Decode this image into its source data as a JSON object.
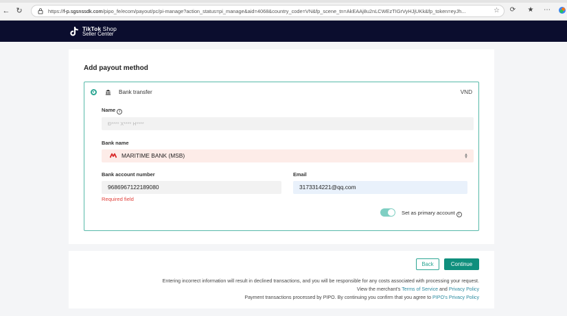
{
  "browser": {
    "url_prefix": "https://",
    "url_host": "f-p.sgsnssdk.com",
    "url_rest": "/pipo_fe/ecom/payout/pc/pi-manage?action_status=pi_manage&aid=4068&country_code=VN&fp_scene_tn=AkEAAj8u2nLCWEzTIGrVyHJjUKk&fp_token=eyJh..."
  },
  "header": {
    "logo_brand": "TikTok",
    "logo_shop": " Shop",
    "logo_sub": "Seller Center"
  },
  "form": {
    "title": "Add payout method",
    "method_label": "Bank transfer",
    "currency": "VND",
    "name_label": "Name",
    "name_placeholder": "Đ**** X**** H****",
    "bank_name_label": "Bank name",
    "bank_name_value": "MARITIME BANK (MSB)",
    "required_text": "Required field",
    "account_label": "Bank account number",
    "account_value": "9686967122189080",
    "email_label": "Email",
    "email_value": "3173314221@qq.com",
    "primary_label": "Set as primary account",
    "primary_on": true
  },
  "footer": {
    "back": "Back",
    "continue": "Continue",
    "warning": "Entering incorrect information will result in declined transactions, and you will be responsible for any costs associated with processing your request.",
    "merchant_prefix": "View the merchant's ",
    "terms": "Terms of Service",
    "and": " and ",
    "privacy": "Privacy Policy",
    "pipo_prefix": "Payment transactions processed by PIPO. By continuing you confirm that you agree to ",
    "pipo_privacy": "PIPO's Privacy Policy"
  },
  "colors": {
    "accent": "#2aa592",
    "header_bg": "#0b0d2e",
    "error": "#e1413b"
  }
}
